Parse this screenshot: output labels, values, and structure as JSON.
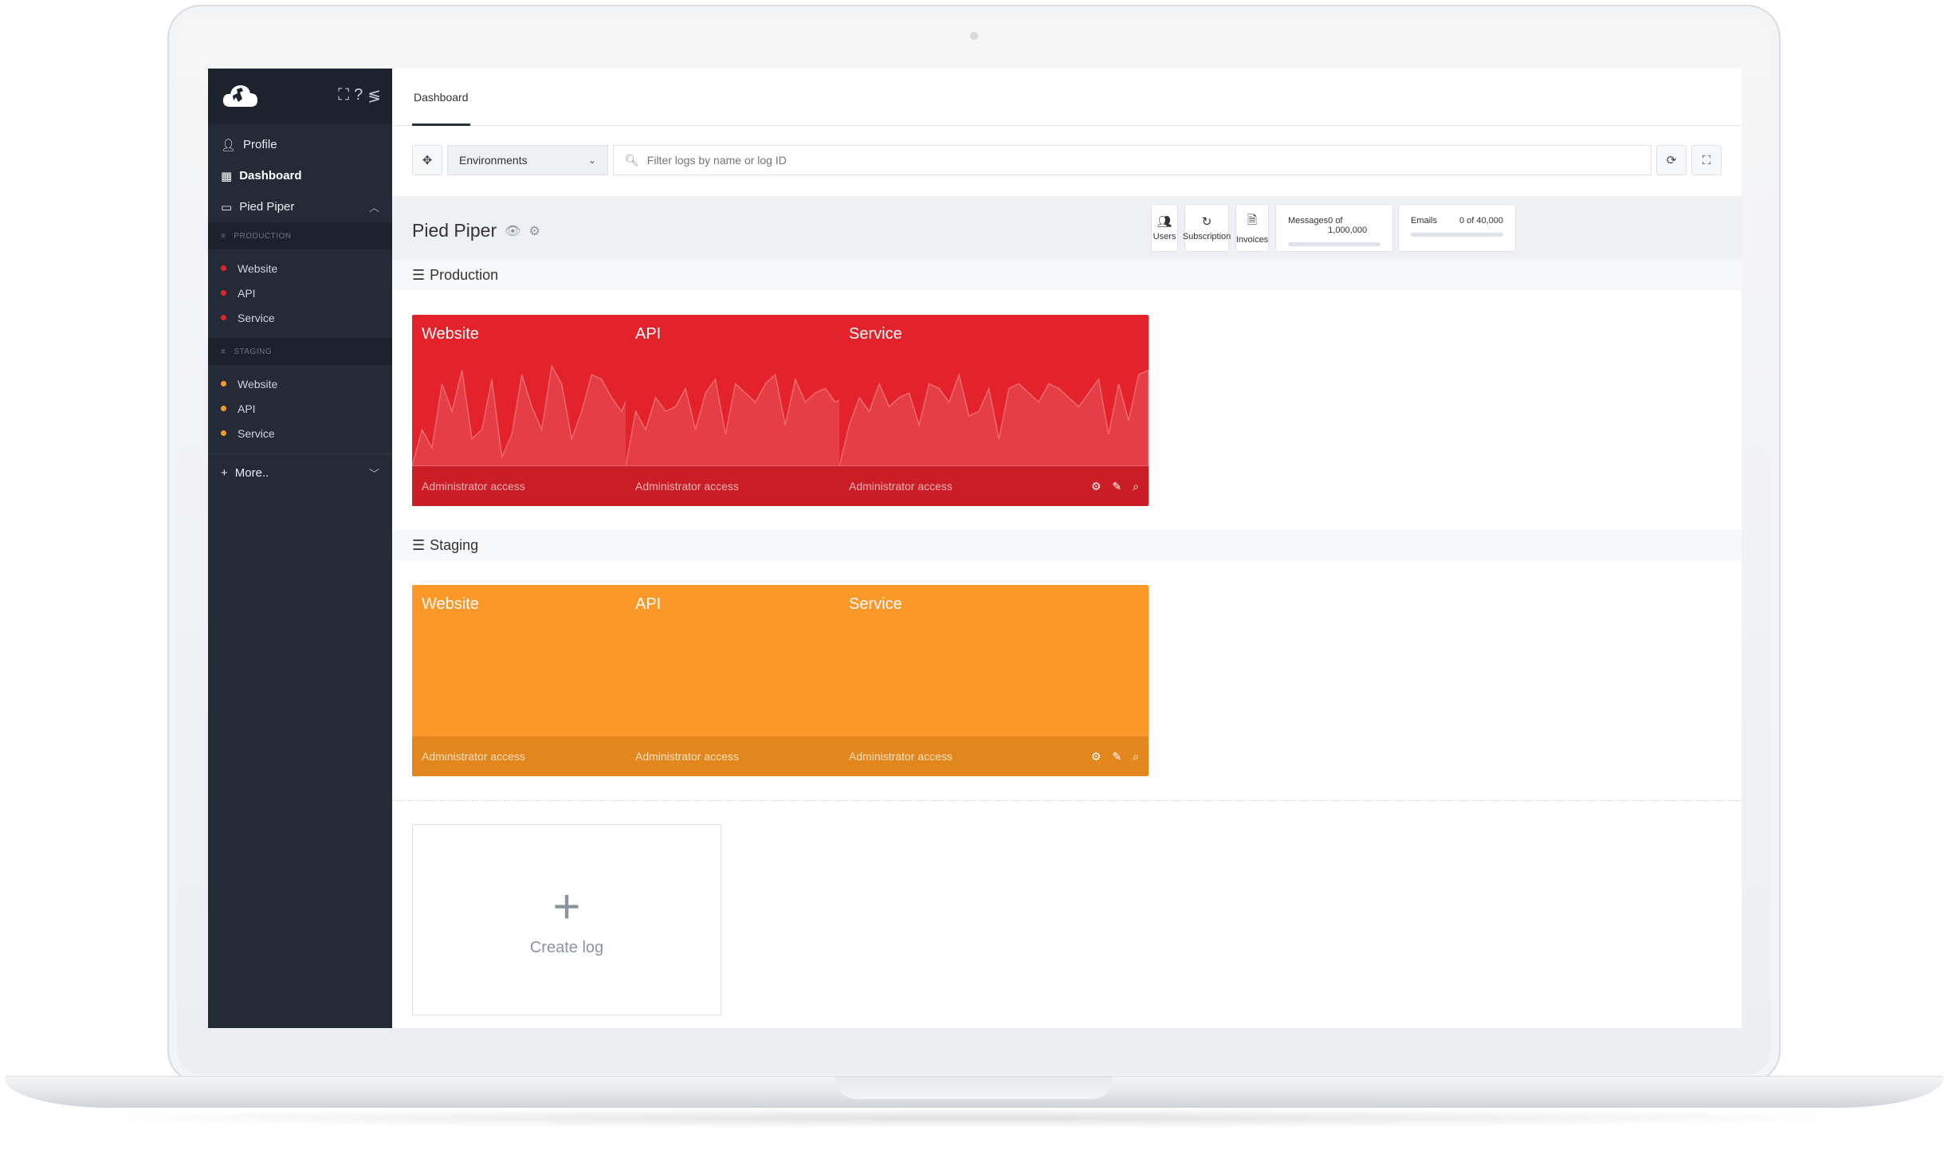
{
  "sidebar": {
    "items": [
      {
        "label": "Profile",
        "icon": "user-icon"
      },
      {
        "label": "Dashboard",
        "icon": "grid-icon"
      },
      {
        "label": "Pied Piper",
        "icon": "folder-icon"
      }
    ],
    "sections": [
      {
        "label": "PRODUCTION",
        "color": "#e3222b",
        "items": [
          "Website",
          "API",
          "Service"
        ]
      },
      {
        "label": "STAGING",
        "color": "#fb9828",
        "items": [
          "Website",
          "API",
          "Service"
        ]
      }
    ],
    "more_label": "More.."
  },
  "tabs": [
    "Dashboard"
  ],
  "toolbar": {
    "environment_value": "Environments",
    "search_placeholder": "Filter logs by name or log ID"
  },
  "project": {
    "title": "Pied Piper",
    "quick_buttons": [
      "Users",
      "Subscription",
      "Invoices"
    ],
    "meters": [
      {
        "label": "Messages",
        "value": "0 of 1,000,000",
        "fraction": 0
      },
      {
        "label": "Emails",
        "value": "0 of 40,000",
        "fraction": 0
      }
    ]
  },
  "groups": [
    {
      "title": "Production",
      "color": "#e3222b",
      "cards": [
        {
          "name": "Website",
          "footer": "Administrator access"
        },
        {
          "name": "API",
          "footer": "Administrator access"
        },
        {
          "name": "Service",
          "footer": "Administrator access"
        }
      ]
    },
    {
      "title": "Staging",
      "color": "#fb9828",
      "cards": [
        {
          "name": "Website",
          "footer": "Administrator access"
        },
        {
          "name": "API",
          "footer": "Administrator access"
        },
        {
          "name": "Service",
          "footer": "Administrator access"
        }
      ]
    }
  ],
  "create_log_label": "Create log"
}
